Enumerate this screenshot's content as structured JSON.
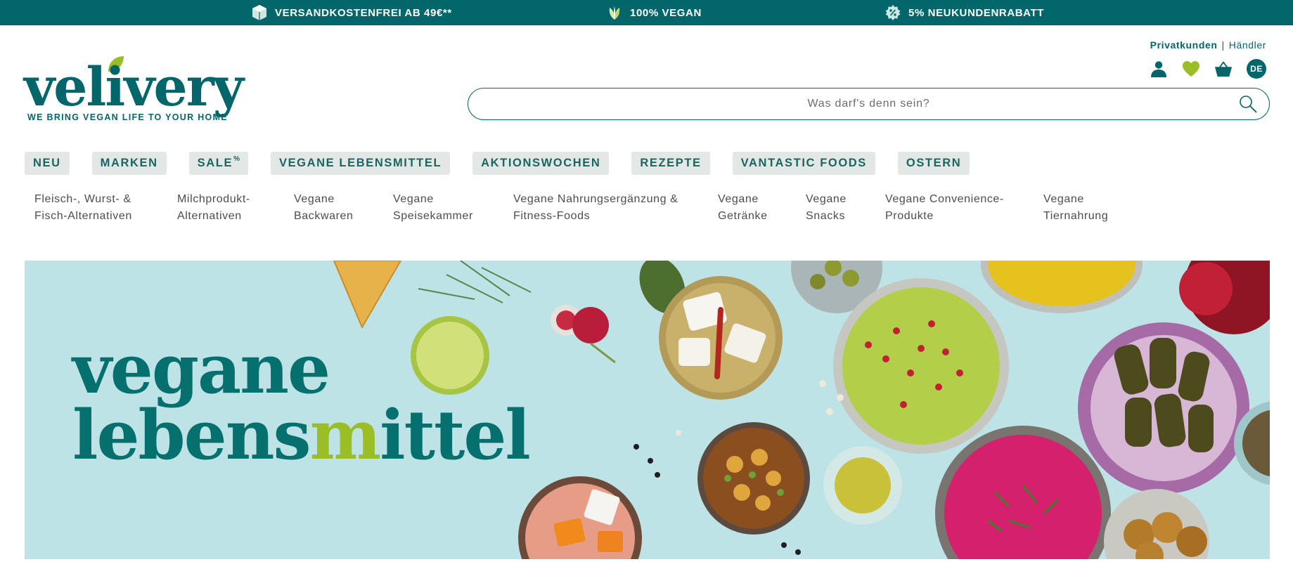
{
  "topbar": {
    "usps": [
      {
        "label": "VERSANDKOSTENFREI AB 49€**",
        "icon": "package-icon"
      },
      {
        "label": "100% VEGAN",
        "icon": "leaf-icon"
      },
      {
        "label": "5% NEUKUNDENRABATT",
        "icon": "discount-badge-icon"
      }
    ],
    "background": "#03666b"
  },
  "header": {
    "logo": {
      "wordmark": "velivery",
      "tagline": "WE BRING VEGAN LIFE TO YOUR HOME"
    },
    "segment": {
      "private": "Privatkunden",
      "separator": "|",
      "dealer": "Händler"
    },
    "icons": [
      "account-icon",
      "heart-icon",
      "cart-icon"
    ],
    "language": "DE",
    "search": {
      "placeholder": "Was darf's denn sein?",
      "value": ""
    }
  },
  "mainnav": {
    "items": [
      {
        "label": "NEU"
      },
      {
        "label": "MARKEN"
      },
      {
        "label": "SALE",
        "sup": "%"
      },
      {
        "label": "VEGANE LEBENSMITTEL"
      },
      {
        "label": "AKTIONSWOCHEN"
      },
      {
        "label": "REZEPTE"
      },
      {
        "label": "VANTASTIC FOODS"
      },
      {
        "label": "OSTERN"
      }
    ]
  },
  "subnav": {
    "items": [
      {
        "line1": "Fleisch-, Wurst- &",
        "line2": "Fisch-Alternativen"
      },
      {
        "line1": "Milchprodukt-",
        "line2": "Alternativen"
      },
      {
        "line1": "Vegane",
        "line2": "Backwaren"
      },
      {
        "line1": "Vegane",
        "line2": "Speisekammer"
      },
      {
        "line1": "Vegane Nahrungsergänzung &",
        "line2": "Fitness-Foods"
      },
      {
        "line1": "Vegane",
        "line2": "Getränke"
      },
      {
        "line1": "Vegane",
        "line2": "Snacks"
      },
      {
        "line1": "Vegane Convenience-",
        "line2": "Produkte"
      },
      {
        "line1": "Vegane",
        "line2": "Tiernahrung"
      }
    ]
  },
  "hero": {
    "line1": "vegane",
    "line2_start": "lebens",
    "line2_accent": "m",
    "line2_end": "ittel",
    "colors": {
      "background": "#bde3e7",
      "text": "#06706e",
      "accent": "#9bbd25"
    }
  }
}
